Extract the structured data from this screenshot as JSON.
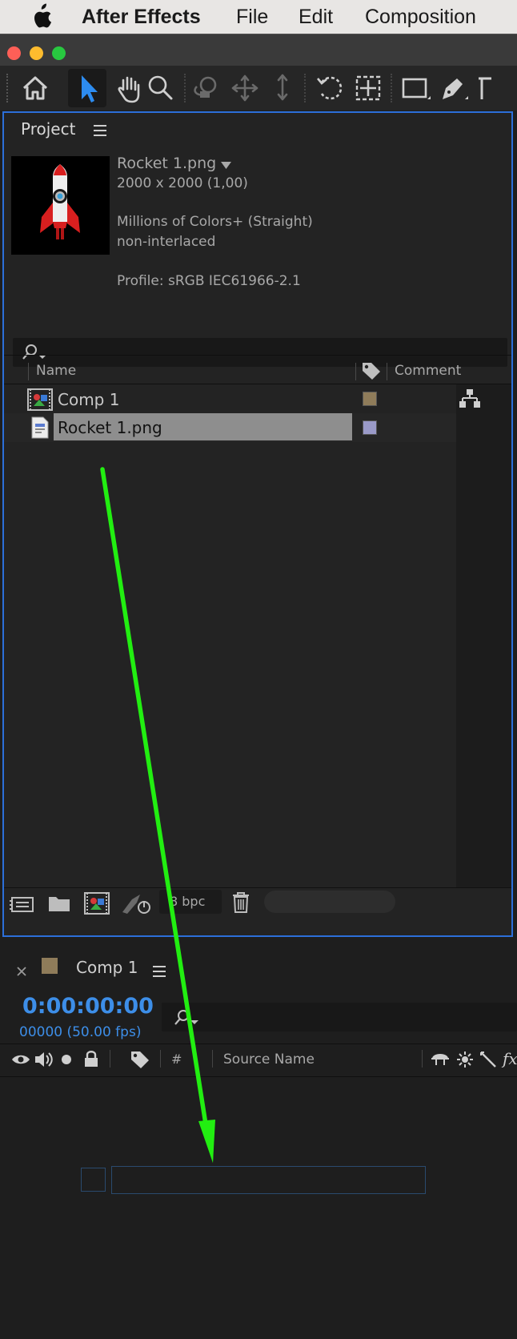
{
  "menubar": {
    "app_name": "After Effects",
    "items": [
      "File",
      "Edit",
      "Composition"
    ]
  },
  "project": {
    "title": "Project",
    "preview": {
      "filename": "Rocket 1.png",
      "dimensions": "2000 x 2000 (1,00)",
      "colors": "Millions of Colors+ (Straight)",
      "interlace": "non-interlaced",
      "profile": "Profile: sRGB IEC61966-2.1"
    },
    "columns": {
      "name": "Name",
      "comment": "Comment"
    },
    "items": [
      {
        "name": "Comp 1",
        "label_color": "#8f7c5a",
        "selected": false
      },
      {
        "name": "Rocket 1.png",
        "label_color": "#9a9ac8",
        "selected": true
      }
    ],
    "bpc": "8 bpc"
  },
  "comp": {
    "title": "Comp 1",
    "label_color": "#8f7c5a",
    "timecode": "0:00:00:00",
    "frames": "00000 (50.00 fps)",
    "columns": {
      "hash": "#",
      "source_name": "Source Name",
      "fx": "fx"
    }
  },
  "colors": {
    "accent": "#2c6fd9",
    "timecode": "#3d8ee8",
    "annotation_arrow": "#22ee11"
  }
}
